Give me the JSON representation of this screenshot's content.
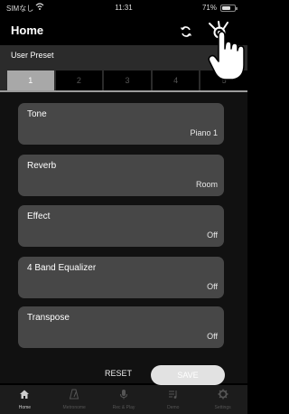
{
  "status_bar": {
    "carrier": "SIMなし",
    "time": "11:31",
    "battery_percent": "71%",
    "battery_level": 0.71
  },
  "nav": {
    "title": "Home",
    "sync_icon": "sync-icon",
    "settings_icon": "settings-gear-icon"
  },
  "preset": {
    "label": "User Preset",
    "tabs": [
      "1",
      "2",
      "3",
      "4",
      "5"
    ],
    "active_tab": "1"
  },
  "settings": [
    {
      "label": "Tone",
      "value": "Piano 1"
    },
    {
      "label": "Reverb",
      "value": "Room"
    },
    {
      "label": "Effect",
      "value": "Off"
    },
    {
      "label": "4 Band Equalizer",
      "value": "Off"
    },
    {
      "label": "Transpose",
      "value": "Off"
    }
  ],
  "actions": {
    "reset_label": "RESET",
    "save_label": "SAVE"
  },
  "tab_bar": {
    "items": [
      {
        "label": "Home",
        "icon": "home-icon"
      },
      {
        "label": "Metronome",
        "icon": "metronome-icon"
      },
      {
        "label": "Rec & Play",
        "icon": "microphone-icon"
      },
      {
        "label": "Demo",
        "icon": "music-list-icon"
      },
      {
        "label": "Settings",
        "icon": "gear-icon"
      }
    ],
    "active": "Home"
  },
  "colors": {
    "background": "#000000",
    "card": "#474747",
    "active_tab": "#a8a8a8",
    "save_button": "#e2e2e2"
  }
}
